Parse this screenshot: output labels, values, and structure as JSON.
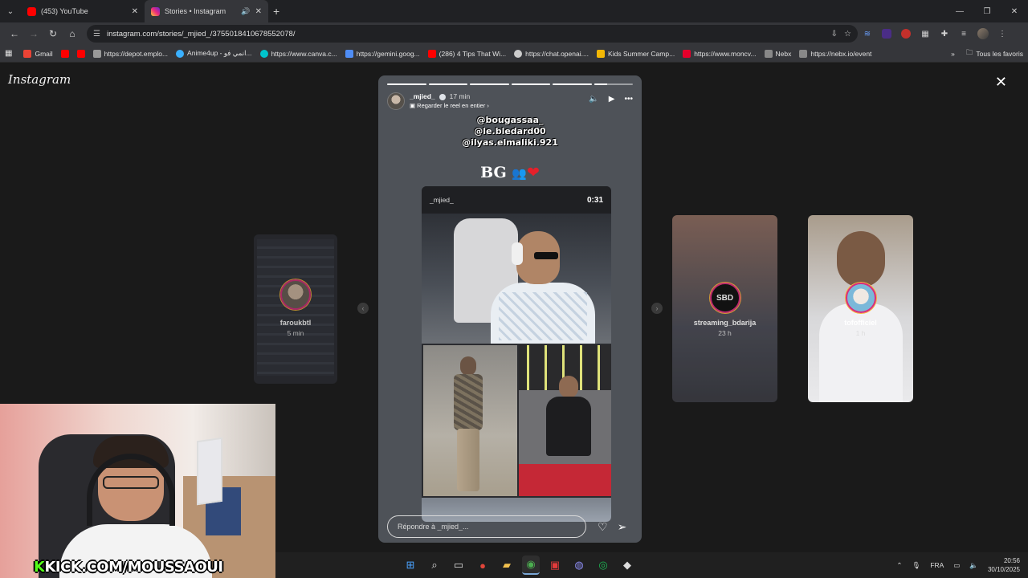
{
  "tabs": [
    {
      "title": "(453) YouTube",
      "favicon_color": "#ff0000",
      "active": false
    },
    {
      "title": "Stories • Instagram",
      "favicon_color": "#d6249f",
      "active": true,
      "audio": true
    }
  ],
  "toolbar": {
    "url": "instagram.com/stories/_mjied_/3755018410678552078/"
  },
  "bookmarks": [
    {
      "label": "Gmail",
      "color": "#ea4335"
    },
    {
      "label": "",
      "color": "#ff0000"
    },
    {
      "label": "",
      "color": "#ff0000"
    },
    {
      "label": "https://depot.emplo...",
      "color": "#999999"
    },
    {
      "label": "Anime4up - انمي فو...",
      "color": "#3ab0ff"
    },
    {
      "label": "https://www.canva.c...",
      "color": "#00c4cc"
    },
    {
      "label": "https://gemini.goog...",
      "color": "#4f8df5"
    },
    {
      "label": "(286) 4 Tips That Wi...",
      "color": "#ff0000"
    },
    {
      "label": "https://chat.openai....",
      "color": "#cccccc"
    },
    {
      "label": "Kids Summer Camp...",
      "color": "#f2b705"
    },
    {
      "label": "https://www.moncv...",
      "color": "#e4002b"
    },
    {
      "label": "Nebx",
      "color": "#888888"
    },
    {
      "label": "https://nebx.io/event",
      "color": "#888888"
    }
  ],
  "bookmarks_right": {
    "label": "Tous les favoris"
  },
  "instagram": {
    "logo": "Instagram",
    "story": {
      "username": "_mjied_",
      "age": "17 min",
      "reel_link": "Regarder le reel en entier",
      "progress": [
        1,
        1,
        1,
        1,
        1,
        0.35
      ],
      "mentions": [
        "@bougassaa_",
        "@le.bledard00",
        "@ilyas.elmaliki.921"
      ],
      "caption": "BG",
      "reel_user": "_mjied_",
      "reel_duration": "0:31",
      "reply_placeholder": "Répondre à _mjied_..."
    },
    "previews": [
      {
        "username": "faroukbtl",
        "age": "5 min"
      },
      {
        "username": "streaming_bdarija",
        "age": "23 h"
      },
      {
        "username": "tofofficiel",
        "age": "1 h"
      }
    ]
  },
  "overlay": {
    "kick_prefix": "K",
    "kick_rest": "KICK.COM/MOUSSAOUI"
  },
  "taskbar": {
    "lang": "FRA",
    "time": "20:56",
    "date": "30/10/2025"
  }
}
